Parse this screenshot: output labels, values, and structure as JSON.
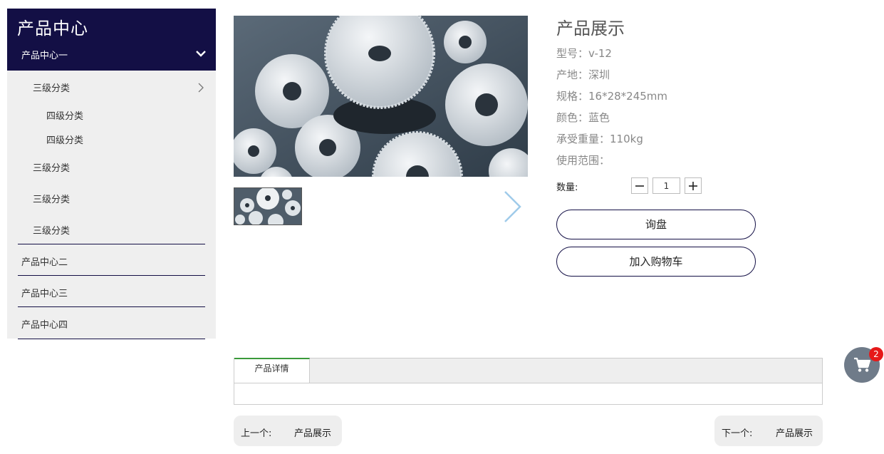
{
  "sidebar": {
    "title": "产品中心",
    "current": "产品中心一",
    "level3": [
      "三级分类",
      "三级分类",
      "三级分类",
      "三级分类"
    ],
    "level4": [
      "四级分类",
      "四级分类"
    ],
    "main_items": [
      "产品中心二",
      "产品中心三",
      "产品中心四"
    ]
  },
  "product": {
    "title": "产品展示",
    "model": "型号：v-12",
    "origin": "产地：深圳",
    "spec": "规格：16*28*245mm",
    "color": "颜色：蓝色",
    "load": "承受重量：110kg",
    "usage": "使用范围：",
    "qty_label": "数量:",
    "qty_value": "1",
    "inquiry_button": "询盘",
    "cart_button": "加入购物车"
  },
  "tabs": {
    "detail": "产品详情"
  },
  "pager": {
    "prev_label": "上一个:",
    "prev_value": "产品展示",
    "next_label": "下一个:",
    "next_value": "产品展示"
  },
  "cart": {
    "count": "2"
  },
  "colors": {
    "brand": "#130f45",
    "tab_accent": "#3a9a3a",
    "badge": "#e61919",
    "fab": "#6f7b89"
  },
  "icons": [
    "chevron-down-icon",
    "chevron-right-icon",
    "next-arrow-icon",
    "minus-icon",
    "plus-icon",
    "cart-icon"
  ]
}
